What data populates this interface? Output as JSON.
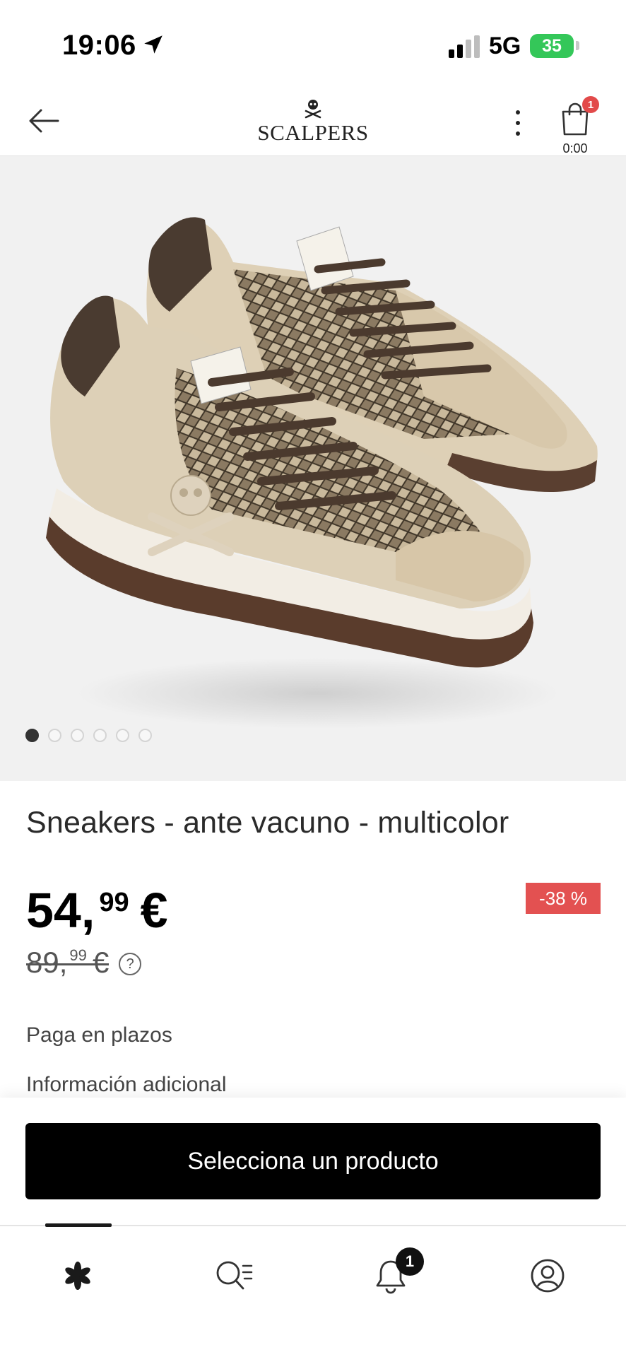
{
  "status_bar": {
    "time": "19:06",
    "network": "5G",
    "battery": "35"
  },
  "header": {
    "brand": "SCALPERS",
    "cart_count": "1",
    "cart_total": "0:00",
    "icons": [
      "back-arrow-icon",
      "skull-logo-icon",
      "more-vertical-icon",
      "shopping-bag-icon"
    ]
  },
  "gallery": {
    "image_count": 6,
    "active_index": 0
  },
  "product": {
    "title": "Sneakers - ante vacuno - multicolor",
    "price_int": "54,",
    "price_dec": "99",
    "currency": "€",
    "old_price_int": "89,",
    "old_price_dec": "99",
    "discount": "-38 %",
    "help_symbol": "?"
  },
  "sections": {
    "installments": "Paga en plazos",
    "additional_info": "Información adicional"
  },
  "cta": {
    "label": "Selecciona un producto"
  },
  "bottom_nav": {
    "notifications_badge": "1",
    "items": [
      "home-flower-icon",
      "search-menu-icon",
      "bell-icon",
      "account-icon"
    ]
  },
  "colors": {
    "accent_red": "#e35151",
    "cta_black": "#000000",
    "battery_green": "#34c759"
  }
}
